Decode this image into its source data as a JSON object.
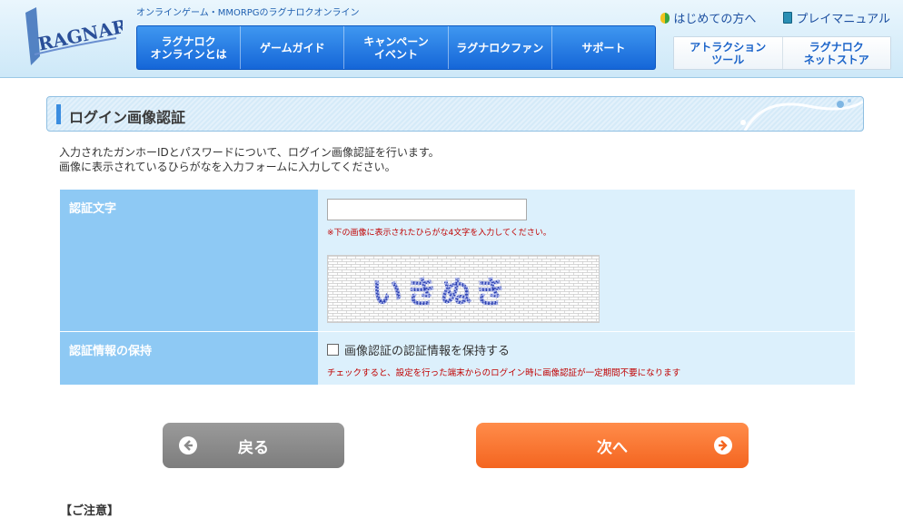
{
  "header": {
    "tagline": "オンラインゲーム・MMORPGのラグナロクオンライン",
    "logo_alt": "RAGNAROK",
    "nav": [
      {
        "label": "ラグナロク\nオンラインとは"
      },
      {
        "label": "ゲームガイド"
      },
      {
        "label": "キャンペーン\nイベント"
      },
      {
        "label": "ラグナロクファン"
      },
      {
        "label": "サポート"
      }
    ],
    "toplinks": [
      {
        "label": "はじめての方へ",
        "icon": "beginner-leaf-icon"
      },
      {
        "label": "プレイマニュアル",
        "icon": "book-icon"
      }
    ],
    "subnav": [
      {
        "label": "アトラクション\nツール"
      },
      {
        "label": "ラグナロク\nネットストア"
      }
    ]
  },
  "page": {
    "title": "ログイン画像認証",
    "description_line1": "入力されたガンホーIDとパスワードについて、ログイン画像認証を行います。",
    "description_line2": "画像に表示されているひらがなを入力フォームに入力してください。"
  },
  "form": {
    "auth_label": "認証文字",
    "auth_value": "",
    "auth_note": "※下の画像に表示されたひらがな4文字を入力してください。",
    "captcha_text": "いきぬき",
    "remember_label": "認証情報の保持",
    "remember_checkbox_label": "画像認証の認証情報を保持する",
    "remember_checked": false,
    "remember_note": "チェックすると、設定を行った端末からのログイン時に画像認証が一定期間不要になります"
  },
  "buttons": {
    "back": "戻る",
    "next": "次へ"
  },
  "footer": {
    "partial_text": "【ご注意】"
  },
  "colors": {
    "nav_blue": "#1566d8",
    "table_header": "#8ec9f4",
    "table_cell": "#dcf0fc",
    "note_red": "#c00000",
    "back_gray": "#8a8a8a",
    "next_orange": "#f46520"
  }
}
